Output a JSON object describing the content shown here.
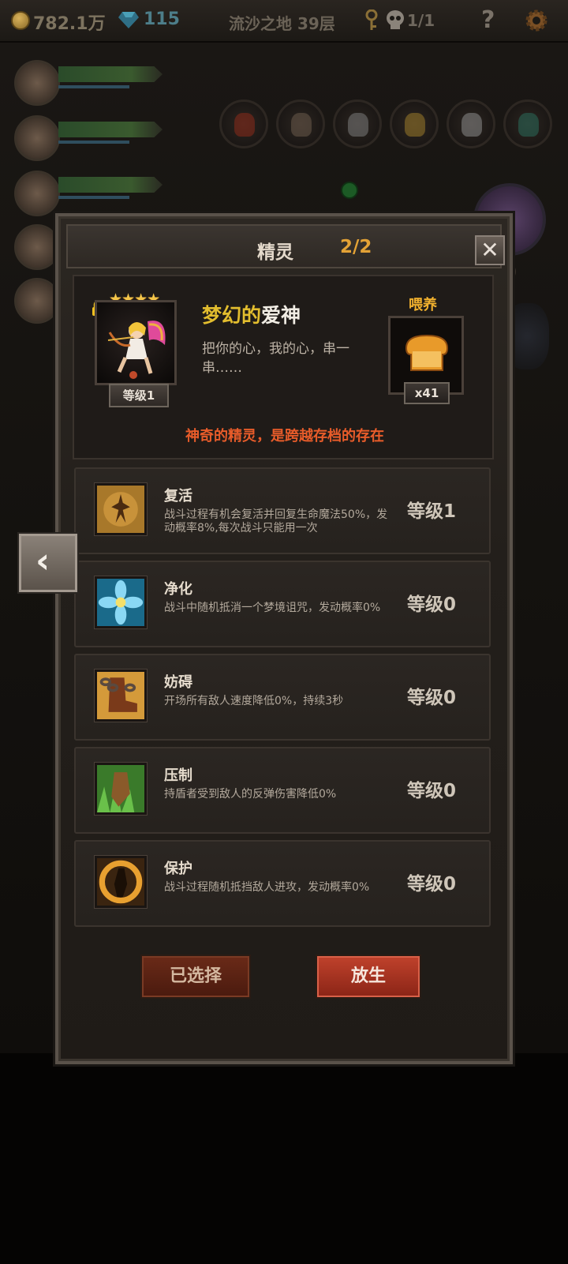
{
  "topbar": {
    "coins": "782.1万",
    "gems": "115",
    "location": "流沙之地 39层",
    "skull_count": "1/1",
    "help_glyph": "?"
  },
  "modal": {
    "title": "精灵",
    "count": "2/2",
    "close_glyph": "✕",
    "sprite": {
      "stars": "★★★★",
      "name_part1": "梦幻的",
      "name_part2": "爱神",
      "description": "把你的心，我的心，串一串……",
      "level": "等级1"
    },
    "feed": {
      "label": "喂养",
      "count": "x41"
    },
    "tagline": "神奇的精灵，是跨越存档的存在",
    "skills": [
      {
        "name": "复活",
        "desc": "战斗过程有机会复活并回复生命魔法50%，发动概率8%,每次战斗只能用一次",
        "level": "等级1"
      },
      {
        "name": "净化",
        "desc": "战斗中随机抵消一个梦境诅咒，发动概率0%",
        "level": "等级0"
      },
      {
        "name": "妨碍",
        "desc": "开场所有敌人速度降低0%，持续3秒",
        "level": "等级0"
      },
      {
        "name": "压制",
        "desc": "持盾者受到敌人的反弹伤害降低0%",
        "level": "等级0"
      },
      {
        "name": "保护",
        "desc": "战斗过程随机抵挡敌人进攻，发动概率0%",
        "level": "等级0"
      }
    ],
    "buttons": {
      "selected": "已选择",
      "release": "放生"
    }
  },
  "side_arrow_glyph": "‹",
  "colors": {
    "accent_gold": "#e3a236",
    "tagline_orange": "#e85c2a",
    "release_red": "#c0422c"
  }
}
